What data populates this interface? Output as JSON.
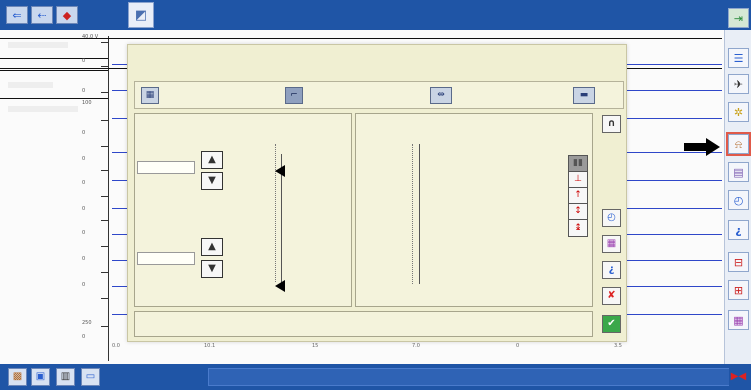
{
  "topbar": {
    "buttons": [
      {
        "icon": "blue-arrow-icon",
        "glyph": "⇐"
      },
      {
        "icon": "blue-arrow-left-icon",
        "glyph": "⇠"
      },
      {
        "icon": "red-car-icon",
        "glyph": "🚗"
      }
    ],
    "tab_icon": "oscilloscope-tab-icon"
  },
  "chart_area": {
    "y_labels": [
      "40.0 V",
      "0",
      "0",
      "100",
      "0",
      "0",
      "0",
      "0",
      "0",
      "0",
      "0",
      "250",
      "0"
    ],
    "x_ticks": [
      "0.0",
      "10.1",
      "15",
      "7.0",
      "0",
      "3.5"
    ]
  },
  "dialog": {
    "tabs": [
      {
        "icon": "grid-settings-icon"
      },
      {
        "icon": "waveform-icon"
      },
      {
        "icon": "horizontal-range-icon"
      },
      {
        "icon": "trigger-position-icon"
      }
    ],
    "side_buttons": [
      {
        "icon": "magnet-icon",
        "glyph": "∩"
      },
      {
        "icon": "stopwatch-icon",
        "glyph": "⏱"
      },
      {
        "icon": "palette-icon",
        "glyph": "▦"
      },
      {
        "icon": "help-icon",
        "glyph": "¿"
      },
      {
        "icon": "cancel-icon",
        "glyph": "✘"
      },
      {
        "icon": "confirm-icon",
        "glyph": "✔"
      }
    ],
    "trigger_stack": [
      {
        "icon": "stack-header-icon",
        "glyph": "▮▮"
      },
      {
        "icon": "trigger-rising-icon",
        "glyph": "⊥"
      },
      {
        "icon": "trigger-up-icon",
        "glyph": "↑"
      },
      {
        "icon": "trigger-both-icon",
        "glyph": "↕"
      },
      {
        "icon": "trigger-level-icon",
        "glyph": "↨"
      }
    ]
  },
  "rightbar": {
    "buttons": [
      {
        "icon": "exit-icon",
        "glyph": "⇥"
      },
      {
        "icon": "list-icon",
        "glyph": "☰"
      },
      {
        "icon": "probe-icon",
        "glyph": "✈"
      },
      {
        "icon": "gear-icon",
        "glyph": "✲"
      },
      {
        "icon": "scope-settings-icon",
        "glyph": "⍾",
        "highlighted": true
      },
      {
        "icon": "display-icon",
        "glyph": "▤"
      },
      {
        "icon": "timer-icon",
        "glyph": "⏱"
      },
      {
        "icon": "help-icon",
        "glyph": "¿"
      },
      {
        "icon": "cursor-icon",
        "glyph": "⊟"
      },
      {
        "icon": "trigger-icon",
        "glyph": "⊞"
      },
      {
        "icon": "color-icon",
        "glyph": "▦"
      }
    ]
  },
  "bottombar": {
    "buttons": [
      {
        "icon": "report-icon",
        "glyph": "🗎"
      },
      {
        "icon": "capture-icon",
        "glyph": "▣"
      },
      {
        "icon": "table-icon",
        "glyph": "▥"
      },
      {
        "icon": "monitor-icon",
        "glyph": "▭"
      }
    ],
    "status_text": "",
    "exit_icon": "exit-red-icon"
  },
  "colors": {
    "chrome_blue": "#1f55a6",
    "dialog_bg": "#f0efd2",
    "trace_blue": "#2f47c9",
    "highlight_red": "#e05a4a"
  }
}
